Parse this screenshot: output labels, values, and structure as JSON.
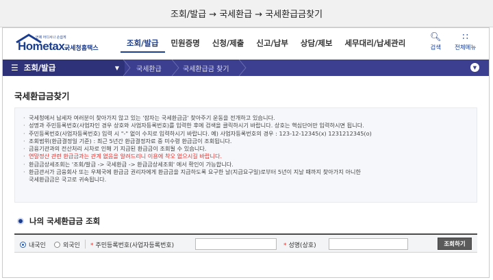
{
  "caption": "조회/발급 → 국세환급 → 국세환급금찾기",
  "brand": {
    "logo_main": "Hometax",
    "logo_dot": ".",
    "logo_sub": "국세청홈택스",
    "logo_tiny": "언제 어디서나 손쉽게"
  },
  "menu": [
    "조회/발급",
    "민원증명",
    "신청/제출",
    "신고/납부",
    "상담/제보",
    "세무대리/납세관리"
  ],
  "utility": {
    "search_label": "검색",
    "all_menu_label": "전체메뉴"
  },
  "lnb": {
    "main": "조회/발급",
    "crumb1": "국세환급",
    "crumb2": "국세환급금 찾기"
  },
  "page_title": "국세환급금찾기",
  "notices": [
    "국세청에서 납세자 여러분이 찾아가지 않고 있는 '잠자는 국세환급금' 찾아주기 운동을 전개하고 있습니다.",
    "성명과 주민등록번호(사업자인 경우 상호와 사업자등록번호)를 입력한 후에 검색을 클릭하시기 바랍니다. 상호는 핵심단어만 입력하시면 됩니다.",
    "주민등록번호(사업자등록번호) 입력 시 \"-\" 없이 수치로 입력하시기 바랍니다. 예) 사업자등록번호의 경우 : 123-12-12345(x) 1231212345(o)",
    "조회범위(환급결정일 기준) : 최근 5년간 환급결정자료 중 미수령 환급금이 조회됩니다.",
    "금융기관과의 전산처리 시차로 인해 기 지급된 환급금이 조회될 수 있습니다.",
    "연말정산 관련 환급금과는 관계 없음을 알려드리니 이용에 착오 없으시길 바랍니다.",
    "환급금상세조회는 '조회/발급 -> 국세환급 -> 환급금상세조회' 에서 확인이 가능합니다.",
    "환급관서가 금융회사 또는 우체국에 환급금 권리자에게 환급금을 지급하도록 요구한 날(지급요구일)로부터 5년이 지날 때까지 찾아가지 아니한",
    "국세환급금은 국고로 귀속됩니다."
  ],
  "section_title": "나의 국세환급금 조회",
  "search": {
    "radio_domestic": "내국인",
    "radio_foreign": "외국인",
    "req_mark": "*",
    "id_label": "주민등록번호(사업자등록번호)",
    "id_value": "",
    "name_label": "성명(상호)",
    "name_value": "",
    "button": "조회하기"
  },
  "colors": {
    "brand": "#1a3d8f",
    "bar": "#3c3f8f",
    "warning": "#e8322d"
  }
}
